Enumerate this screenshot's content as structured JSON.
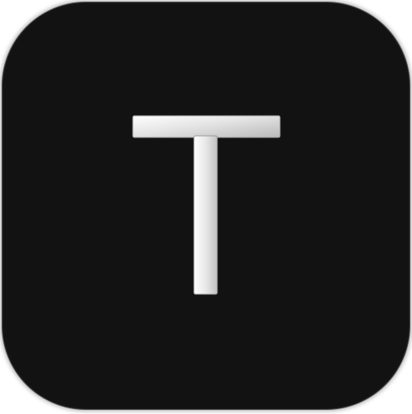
{
  "icon": {
    "glyph_name": "letter-t-glyph",
    "background_color": "#121212",
    "glyph_color": "#e6e6e6"
  }
}
